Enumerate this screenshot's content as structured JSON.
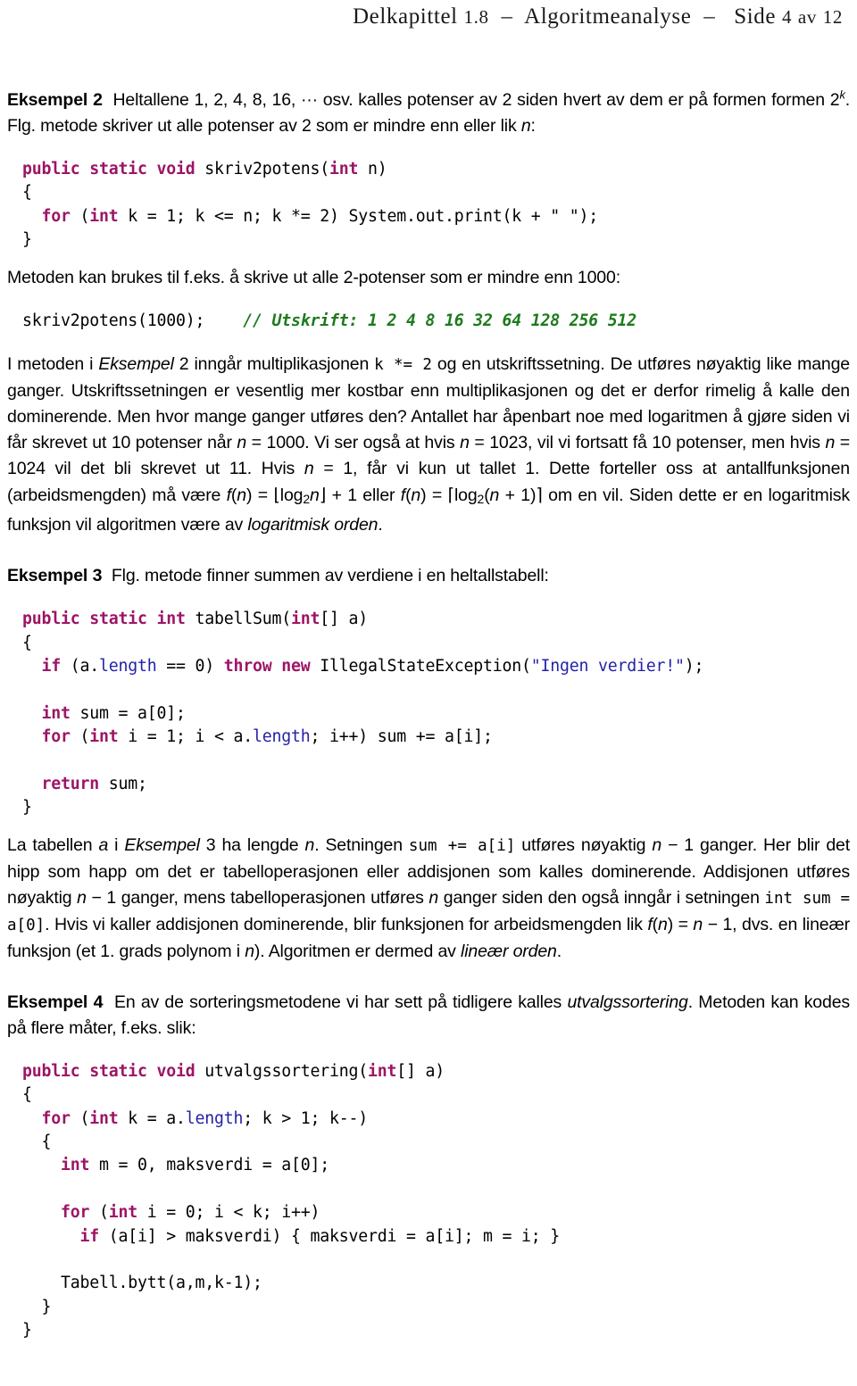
{
  "header": {
    "chapter": "Delkapittel",
    "chapter_number": "1.8",
    "dash": "–",
    "topic": "Algoritmeanalyse",
    "dash2": "–",
    "page_word": "Side",
    "page_number": "4",
    "of_word": "av",
    "page_total": "12"
  },
  "colors": {
    "keyword": "#9c1566",
    "field": "#2222a8",
    "string": "#2222a8",
    "comment": "#1e7a1e",
    "text": "#000000",
    "background": "#ffffff"
  },
  "example2": {
    "label": "Eksempel 2",
    "intro_a": "Heltallene 1, 2, 4, 8, 16, ",
    "dots": "···",
    "intro_b": " osv. kalles potenser av 2 siden hvert av dem er på formen formen 2",
    "exponent": "k",
    "intro_c": ". Flg. metode skriver ut alle potenser av 2 som er mindre enn eller lik ",
    "var_n": "n",
    "intro_d": ":",
    "code": {
      "l1_kw": "public static void",
      "l1_rest": " skriv2potens(",
      "l1_kw2": "int",
      "l1_rest2": " n)",
      "l2": "{",
      "l3_kw": "for",
      "l3_a": " (",
      "l3_kw2": "int",
      "l3_b": " k = 1; k <= n; k *= 2) System.out.print(k + \" \");",
      "l4": "}"
    },
    "after_a": "Metoden kan brukes til f.eks. å skrive ut alle 2-potenser som er mindre enn 1000:",
    "call_code": "skriv2potens(1000);",
    "call_comment": "// Utskrift: 1 2 4 8 16 32 64 128 256 512"
  },
  "para_logarithmic": {
    "s1": "I metoden i ",
    "em1": "Eksempel",
    "s2": " 2 inngår multiplikasjonen ",
    "code1": "k *= 2",
    "s3": " og en utskriftssetning. De utføres nøyaktig like mange ganger. Utskriftssetningen er vesentlig mer kostbar enn multiplikasjonen og det er derfor rimelig å kalle den dominerende. Men hvor mange ganger utføres den? Antallet har åpenbart noe med logaritmen å gjøre siden vi får skrevet ut 10 potenser når ",
    "n1": "n",
    "s4": " = 1000. Vi ser også at hvis ",
    "n2": "n",
    "s5": " = 1023, vil vi fortsatt få 10 potenser, men hvis ",
    "n3": "n",
    "s6": " = 1024 vil det bli skrevet ut 11. Hvis ",
    "n4": "n",
    "s7": " = 1, får vi kun ut tallet 1. Dette forteller oss at antallfunksjonen (arbeidsmengden) må være ",
    "f1": "f",
    "f1_arg": "(",
    "n5": "n",
    "f1_close": ")",
    "s8": " = ",
    "floor_open": "⌊",
    "log1": "log",
    "sub1": "2",
    "n6": "n",
    "floor_close": "⌋",
    "s9": " + 1 eller ",
    "f2": "f",
    "f2_arg": "(",
    "n7": "n",
    "f2_close": ")",
    "s10": " = ",
    "ceil_open": "⌈",
    "log2": "log",
    "sub2": "2",
    "s11": "(",
    "n8": "n",
    "s12": " + 1)",
    "ceil_close": "⌉",
    "s13": " om en vil. Siden dette er en logaritmisk funksjon vil algoritmen være av ",
    "em2": "logaritmisk orden",
    "s14": "."
  },
  "example3": {
    "label": "Eksempel 3",
    "intro": "Flg. metode finner summen av verdiene i en heltallstabell:",
    "code": {
      "l1_kw": "public static int",
      "l1_a": " tabellSum(",
      "l1_kw2": "int",
      "l1_b": "[] a)",
      "l2": "{",
      "l3_kw": "if",
      "l3_a": " (a.",
      "l3_fld": "length",
      "l3_b": " == 0) ",
      "l3_kw2": "throw new",
      "l3_c": " IllegalStateException(",
      "l3_str": "\"Ingen verdier!\"",
      "l3_d": ");",
      "l5_kw": "int",
      "l5_a": " sum = a[0];",
      "l6_kw": "for",
      "l6_a": " (",
      "l6_kw2": "int",
      "l6_b": " i = 1; i < a.",
      "l6_fld": "length",
      "l6_c": "; i++) sum += a[i];",
      "l8_kw": "return",
      "l8_a": " sum;",
      "l9": "}"
    }
  },
  "para_linear": {
    "s1": "La tabellen ",
    "a1": "a",
    "s2": " i ",
    "em1": "Eksempel",
    "s3": " 3 ha lengde ",
    "n1": "n",
    "s4": ". Setningen ",
    "code1": "sum += a[i]",
    "s5": " utføres nøyaktig ",
    "n2": "n",
    "s6": " − 1 ganger. Her blir det hipp som happ om det er tabelloperasjonen eller addisjonen som kalles dominerende. Addisjonen utføres nøyaktig ",
    "n3": "n",
    "s7": " − 1 ganger, mens tabelloperasjonen utføres ",
    "n4": "n",
    "s8": " ganger siden den også inngår i setningen ",
    "code2": "int sum = a[0]",
    "s9": ". Hvis vi kaller addisjonen dominerende, blir funksjonen for arbeidsmengden lik ",
    "f1": "f",
    "f1_a": "(",
    "n5": "n",
    "f1_b": ")",
    "s10": " = ",
    "n6": "n",
    "s11": " − 1, dvs. en lineær funksjon (et 1. grads polynom i ",
    "n7": "n",
    "s12": "). Algoritmen er dermed av ",
    "em2": "lineær orden",
    "s13": "."
  },
  "example4": {
    "label": "Eksempel 4",
    "intro_a": "En av de sorteringsmetodene vi har sett på tidligere kalles ",
    "em1": "utvalgssortering",
    "intro_b": ". Metoden kan kodes på flere måter, f.eks. slik:",
    "code": {
      "l1_kw": "public static void",
      "l1_a": " utvalgssortering(",
      "l1_kw2": "int",
      "l1_b": "[] a)",
      "l2": "{",
      "l3_kw": "for",
      "l3_a": " (",
      "l3_kw2": "int",
      "l3_b": " k = a.",
      "l3_fld": "length",
      "l3_c": "; k > 1; k--)",
      "l4": "  {",
      "l5_kw": "int",
      "l5_a": " m = 0, maksverdi = a[0];",
      "l7_kw": "for",
      "l7_a": " (",
      "l7_kw2": "int",
      "l7_b": " i = 0; i < k; i++)",
      "l8_kw": "if",
      "l8_a": " (a[i] > maksverdi) { maksverdi = a[i]; m = i; }",
      "l10": "    Tabell.bytt(a,m,k-1);",
      "l11": "  }",
      "l12": "}"
    }
  }
}
